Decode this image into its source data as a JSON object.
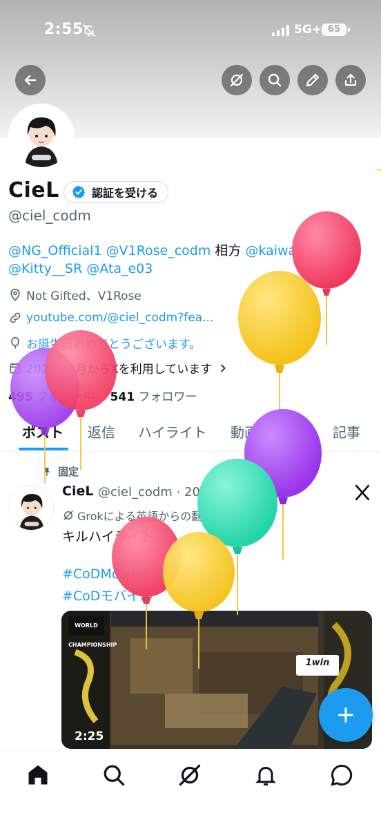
{
  "status_bar": {
    "time": "2:55",
    "network": "5G+",
    "battery": "65"
  },
  "header": {
    "back_icon": "arrow-left-icon",
    "actions": [
      "grok-icon",
      "search-icon",
      "edit-icon",
      "share-icon"
    ]
  },
  "profile": {
    "display_name": "CieL",
    "verify_label": "認証を受ける",
    "handle": "@ciel_codm",
    "bio": {
      "m1": "@NG_Official1",
      "m2": "@V1Rose_codm",
      "sep": "相方",
      "m3": "@kaiware_0507_",
      "m4": "@Kitty__SR",
      "m5": "@Ata_e03"
    },
    "location": "Not Gifted、V1Rose",
    "website": "youtube.com/@ciel_codm?fea...",
    "birthday": "お誕生日おめでとうございます。",
    "joined": "2021年9月からXを利用しています",
    "following_count": "495",
    "following_label": "フォロー中",
    "followers_count": "541",
    "followers_label": "フォロワー"
  },
  "tabs": [
    "ポスト",
    "返信",
    "ハイライト",
    "動画",
    "画像",
    "記事"
  ],
  "post": {
    "pinned_label": "固定",
    "author": "CieL",
    "handle_date": "@ciel_codm · 2025/09/13",
    "translation_note": "Grokによる英語からの翻訳",
    "show_original": "原文を表示",
    "text": "キルハイライト",
    "hashtag1": "#CoDMobile",
    "hashtag2": "#CoDモバイル",
    "video_duration": "2:25",
    "video_badge": "1win",
    "video_logo": "WORLD CHAMPIONSHIP"
  },
  "fab_icon": "plus-icon",
  "bottom_nav": [
    "home-icon",
    "search-icon",
    "grok-icon",
    "bell-icon",
    "message-icon"
  ],
  "colors": {
    "accent": "#1d9bf0",
    "text": "#0f1419",
    "secondary": "#536471"
  }
}
